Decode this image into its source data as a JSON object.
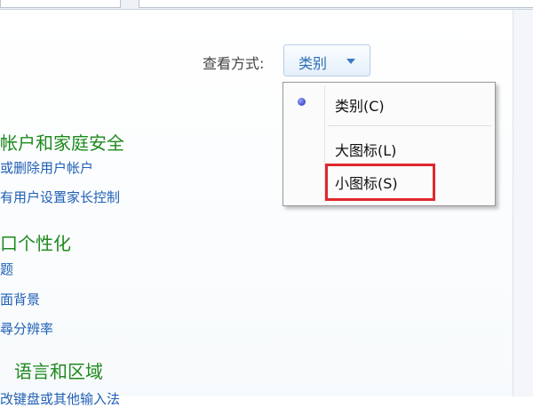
{
  "toolbar": {
    "view_label": "查看方式:",
    "view_value": "类别"
  },
  "view_menu": {
    "items": [
      {
        "label": "类别(C)",
        "selected": true
      },
      {
        "label": "大图标(L)",
        "selected": false
      },
      {
        "label": "小图标(S)",
        "selected": false,
        "highlighted": true
      }
    ]
  },
  "categories": [
    {
      "title": "帐户和家庭安全",
      "links": [
        "或删除用户帐户",
        "有用户设置家长控制"
      ]
    },
    {
      "title": "口个性化",
      "links": [
        "题",
        "面背景",
        "尋分辨率"
      ]
    },
    {
      "title": "语言和区域",
      "links": [
        "改键盘或其他输入法"
      ]
    }
  ],
  "colors": {
    "category_title": "#1e8a1e",
    "link": "#1f5fb5",
    "highlight": "#e0282d",
    "view_value": "#2e6db3"
  }
}
